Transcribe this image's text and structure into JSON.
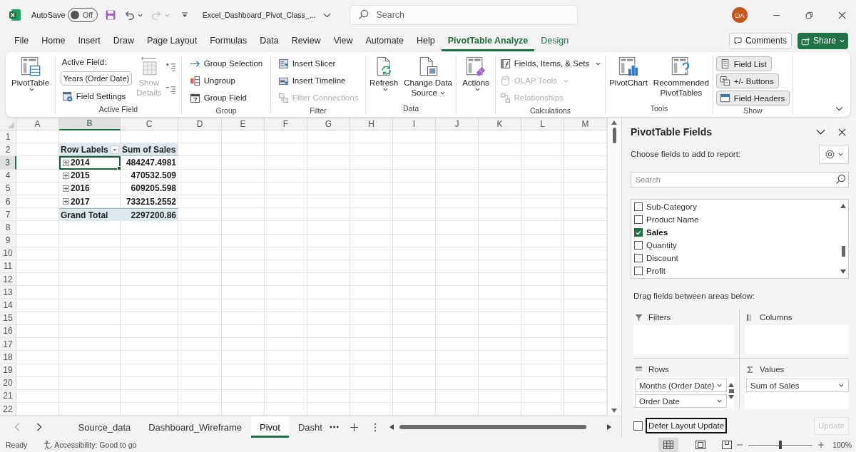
{
  "title_bar": {
    "autosave": {
      "label": "AutoSave",
      "on": false,
      "state_text": "Off"
    },
    "file_name": "Excel_Dashboard_Pivot_Class_...",
    "search": {
      "placeholder": "Search"
    },
    "avatar": {
      "initials": "DA"
    }
  },
  "ribbon_tabs": [
    {
      "label": "File",
      "selected": false,
      "contextual": false
    },
    {
      "label": "Home",
      "selected": false,
      "contextual": false
    },
    {
      "label": "Insert",
      "selected": false,
      "contextual": false
    },
    {
      "label": "Draw",
      "selected": false,
      "contextual": false
    },
    {
      "label": "Page Layout",
      "selected": false,
      "contextual": false
    },
    {
      "label": "Formulas",
      "selected": false,
      "contextual": false
    },
    {
      "label": "Data",
      "selected": false,
      "contextual": false
    },
    {
      "label": "Review",
      "selected": false,
      "contextual": false
    },
    {
      "label": "View",
      "selected": false,
      "contextual": false
    },
    {
      "label": "Automate",
      "selected": false,
      "contextual": false
    },
    {
      "label": "Help",
      "selected": false,
      "contextual": false
    },
    {
      "label": "PivotTable Analyze",
      "selected": true,
      "contextual": true
    },
    {
      "label": "Design",
      "selected": false,
      "contextual": true
    }
  ],
  "header_buttons": {
    "comments": "Comments",
    "share": "Share"
  },
  "ribbon": {
    "groups": [
      {
        "columns": [
          {
            "kind": "large",
            "button": {
              "kind": "pivottable",
              "lines": [
                "PivotTable"
              ],
              "dropdown": true,
              "disabled": false
            }
          }
        ]
      },
      {
        "label": "Active Field",
        "columns": [
          {
            "kind": "stack",
            "items": [
              {
                "kind": "caption",
                "label": "Active Field:",
                "disabled": false
              },
              {
                "kind": "field",
                "value": "Years (Order Date)",
                "disabled": false
              },
              {
                "kind": "field_settings",
                "label": "Field Settings",
                "dropdown": false,
                "disabled": false
              }
            ]
          },
          {
            "kind": "large",
            "button": {
              "kind": "show_details",
              "lines": [
                "Show",
                "Details"
              ],
              "dropdown": false,
              "disabled": true
            }
          },
          {
            "kind": "stack",
            "items": [
              {
                "kind": "expand_field",
                "dropdown": false,
                "disabled": false
              },
              {
                "kind": "collapse_field",
                "dropdown": false,
                "disabled": false
              }
            ]
          }
        ]
      },
      {
        "label": "Group",
        "columns": [
          {
            "kind": "stack",
            "items": [
              {
                "kind": "group_selection",
                "label": "Group Selection",
                "dropdown": false,
                "disabled": false
              },
              {
                "kind": "ungroup",
                "label": "Ungroup",
                "dropdown": false,
                "disabled": false
              },
              {
                "kind": "group_field",
                "label": "Group Field",
                "dropdown": false,
                "disabled": false
              }
            ]
          }
        ]
      },
      {
        "label": "Filter",
        "columns": [
          {
            "kind": "stack",
            "items": [
              {
                "kind": "insert_slicer",
                "label": "Insert Slicer",
                "dropdown": false,
                "disabled": false
              },
              {
                "kind": "insert_timeline",
                "label": "Insert Timeline",
                "dropdown": false,
                "disabled": false
              },
              {
                "kind": "filter_connections",
                "label": "Filter Connections",
                "dropdown": false,
                "disabled": true
              }
            ]
          }
        ]
      },
      {
        "label": "Data",
        "columns": [
          {
            "kind": "large",
            "button": {
              "kind": "refresh",
              "lines": [
                "Refresh"
              ],
              "dropdown": true,
              "disabled": false
            }
          },
          {
            "kind": "large",
            "button": {
              "kind": "change_source",
              "lines": [
                "Change Data",
                "Source"
              ],
              "dropdown": true,
              "disabled": false
            }
          }
        ]
      },
      {
        "columns": [
          {
            "kind": "large",
            "button": {
              "kind": "actions",
              "lines": [
                "Actions"
              ],
              "dropdown": true,
              "disabled": false
            }
          }
        ]
      },
      {
        "label": "Calculations",
        "columns": [
          {
            "kind": "stack",
            "items": [
              {
                "kind": "fields_items",
                "label": "Fields, Items, & Sets",
                "dropdown": true,
                "disabled": false
              },
              {
                "kind": "olap",
                "label": "OLAP Tools",
                "dropdown": true,
                "disabled": true
              },
              {
                "kind": "relationships",
                "label": "Relationships",
                "dropdown": false,
                "disabled": true
              }
            ]
          }
        ]
      },
      {
        "label": "Tools",
        "columns": [
          {
            "kind": "large",
            "button": {
              "kind": "pivotchart",
              "lines": [
                "PivotChart"
              ],
              "dropdown": false,
              "disabled": false
            }
          },
          {
            "kind": "large",
            "button": {
              "kind": "recommended",
              "lines": [
                "Recommended",
                "PivotTables"
              ],
              "dropdown": false,
              "disabled": false
            }
          }
        ]
      },
      {
        "label": "Show",
        "columns": [
          {
            "kind": "toggles",
            "items": [
              {
                "kind": "field_list",
                "label": "Field List",
                "on": true
              },
              {
                "kind": "plus_minus",
                "label": "+/- Buttons",
                "on": true
              },
              {
                "kind": "field_headers",
                "label": "Field Headers",
                "on": true
              }
            ]
          }
        ]
      }
    ]
  },
  "sheet": {
    "columns": [
      {
        "label": "A",
        "selected": false
      },
      {
        "label": "B",
        "selected": true
      },
      {
        "label": "C",
        "selected": false
      },
      {
        "label": "D",
        "selected": false
      },
      {
        "label": "E",
        "selected": false
      },
      {
        "label": "F",
        "selected": false
      },
      {
        "label": "G",
        "selected": false
      },
      {
        "label": "H",
        "selected": false
      },
      {
        "label": "I",
        "selected": false
      },
      {
        "label": "J",
        "selected": false
      },
      {
        "label": "K",
        "selected": false
      },
      {
        "label": "L",
        "selected": false
      },
      {
        "label": "M",
        "selected": false
      }
    ],
    "rows": [
      {
        "label": "1",
        "selected": false
      },
      {
        "label": "2",
        "selected": false
      },
      {
        "label": "3",
        "selected": true
      },
      {
        "label": "4",
        "selected": false
      },
      {
        "label": "5",
        "selected": false
      },
      {
        "label": "6",
        "selected": false
      },
      {
        "label": "7",
        "selected": false
      },
      {
        "label": "8",
        "selected": false
      },
      {
        "label": "9",
        "selected": false
      },
      {
        "label": "10",
        "selected": false
      },
      {
        "label": "11",
        "selected": false
      },
      {
        "label": "12",
        "selected": false
      },
      {
        "label": "13",
        "selected": false
      },
      {
        "label": "14",
        "selected": false
      },
      {
        "label": "15",
        "selected": false
      },
      {
        "label": "16",
        "selected": false
      },
      {
        "label": "17",
        "selected": false
      },
      {
        "label": "18",
        "selected": false
      },
      {
        "label": "19",
        "selected": false
      },
      {
        "label": "20",
        "selected": false
      },
      {
        "label": "21",
        "selected": false
      },
      {
        "label": "22",
        "selected": false
      }
    ],
    "pivot_table": {
      "headers": [
        "Row Labels",
        "Sum of Sales"
      ],
      "rows": [
        {
          "label": "2014",
          "value": "484247.4981",
          "expanded": false,
          "selected": true
        },
        {
          "label": "2015",
          "value": "470532.509",
          "expanded": false,
          "selected": false
        },
        {
          "label": "2016",
          "value": "609205.598",
          "expanded": false,
          "selected": false
        },
        {
          "label": "2017",
          "value": "733215.2552",
          "expanded": false,
          "selected": false
        }
      ],
      "total": {
        "label": "Grand Total",
        "value": "2297200.86"
      }
    }
  },
  "sheet_tabs": [
    {
      "label": "Source_data",
      "selected": false
    },
    {
      "label": "Dashboard_Wireframe",
      "selected": false
    },
    {
      "label": "Pivot",
      "selected": true
    },
    {
      "label": "Dasht",
      "selected": false
    }
  ],
  "field_pane": {
    "title": "PivotTable Fields",
    "instruction": "Choose fields to add to report:",
    "search": {
      "placeholder": "Search"
    },
    "fields": [
      {
        "label": "Sub-Category",
        "checked": false
      },
      {
        "label": "Product Name",
        "checked": false
      },
      {
        "label": "Sales",
        "checked": true
      },
      {
        "label": "Quantity",
        "checked": false
      },
      {
        "label": "Discount",
        "checked": false
      },
      {
        "label": "Profit",
        "checked": false
      }
    ],
    "areas_hint": "Drag fields between areas below:",
    "areas": [
      {
        "kind": "filters",
        "label": "Filters"
      },
      {
        "kind": "columns",
        "label": "Columns"
      },
      {
        "kind": "rows",
        "label": "Rows",
        "items": [
          "Months (Order Date)",
          "Order Date"
        ]
      },
      {
        "kind": "values",
        "label": "Values",
        "items": [
          "Sum of Sales"
        ]
      }
    ],
    "defer_update": {
      "label": "Defer Layout Update",
      "checked": false,
      "focused": true
    },
    "update_button": {
      "label": "Update",
      "disabled": true
    }
  },
  "status_bar": {
    "status": "Ready",
    "accessibility": "Accessibility: Good to go",
    "views": [
      {
        "kind": "normal",
        "selected": true
      },
      {
        "kind": "page_layout",
        "selected": false
      },
      {
        "kind": "page_break",
        "selected": false
      }
    ],
    "zoom": {
      "level": 0.5,
      "reading": "100%"
    }
  }
}
